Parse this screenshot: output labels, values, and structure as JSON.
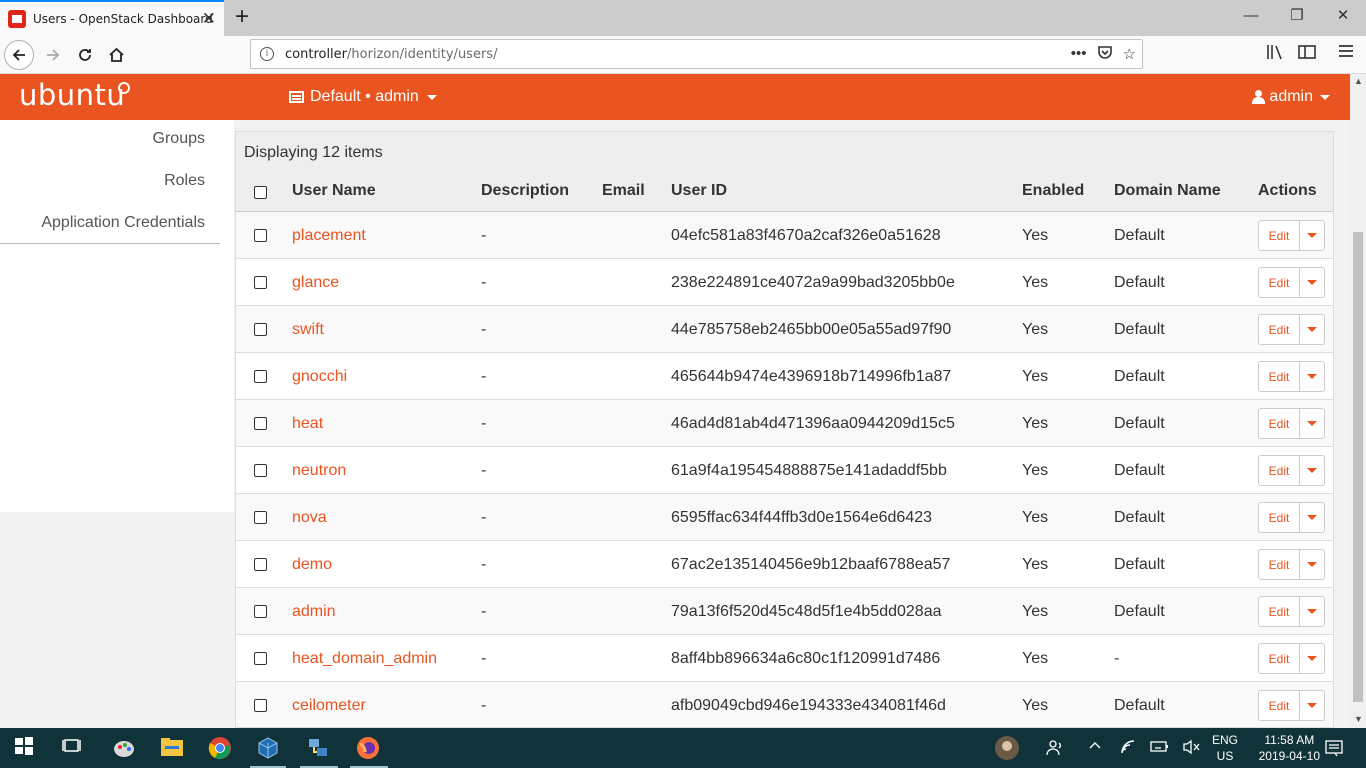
{
  "browser": {
    "tab_title": "Users - OpenStack Dashboard",
    "tab_close": "✕",
    "new_tab": "+",
    "url_host": "controller",
    "url_path": "/horizon/identity/users/",
    "window_controls": [
      "—",
      "❐",
      "✕"
    ]
  },
  "header": {
    "brand": "ubuntu",
    "project": "Default • admin",
    "user": "admin",
    "color": "#e95420"
  },
  "sidebar": {
    "items": [
      {
        "label": "Groups"
      },
      {
        "label": "Roles"
      },
      {
        "label": "Application Credentials"
      }
    ]
  },
  "table": {
    "count_text": "Displaying 12 items",
    "columns": [
      "User Name",
      "Description",
      "Email",
      "User ID",
      "Enabled",
      "Domain Name",
      "Actions"
    ],
    "edit_label": "Edit",
    "rows": [
      {
        "name": "placement",
        "description": "-",
        "email": "",
        "id": "04efc581a83f4670a2caf326e0a51628",
        "enabled": "Yes",
        "domain": "Default"
      },
      {
        "name": "glance",
        "description": "-",
        "email": "",
        "id": "238e224891ce4072a9a99bad3205bb0e",
        "enabled": "Yes",
        "domain": "Default"
      },
      {
        "name": "swift",
        "description": "-",
        "email": "",
        "id": "44e785758eb2465bb00e05a55ad97f90",
        "enabled": "Yes",
        "domain": "Default"
      },
      {
        "name": "gnocchi",
        "description": "-",
        "email": "",
        "id": "465644b9474e4396918b714996fb1a87",
        "enabled": "Yes",
        "domain": "Default"
      },
      {
        "name": "heat",
        "description": "-",
        "email": "",
        "id": "46ad4d81ab4d471396aa0944209d15c5",
        "enabled": "Yes",
        "domain": "Default"
      },
      {
        "name": "neutron",
        "description": "-",
        "email": "",
        "id": "61a9f4a195454888875e141adaddf5bb",
        "enabled": "Yes",
        "domain": "Default"
      },
      {
        "name": "nova",
        "description": "-",
        "email": "",
        "id": "6595ffac634f44ffb3d0e1564e6d6423",
        "enabled": "Yes",
        "domain": "Default"
      },
      {
        "name": "demo",
        "description": "-",
        "email": "",
        "id": "67ac2e135140456e9b12baaf6788ea57",
        "enabled": "Yes",
        "domain": "Default"
      },
      {
        "name": "admin",
        "description": "-",
        "email": "",
        "id": "79a13f6f520d45c48d5f1e4b5dd028aa",
        "enabled": "Yes",
        "domain": "Default"
      },
      {
        "name": "heat_domain_admin",
        "description": "-",
        "email": "",
        "id": "8aff4bb896634a6c80c1f120991d7486",
        "enabled": "Yes",
        "domain": "-"
      },
      {
        "name": "ceilometer",
        "description": "-",
        "email": "",
        "id": "afb09049cbd946e194333e434081f46d",
        "enabled": "Yes",
        "domain": "Default"
      }
    ]
  },
  "taskbar": {
    "lang": "ENG",
    "region": "US",
    "time": "11:58 AM",
    "date": "2019-04-10"
  }
}
